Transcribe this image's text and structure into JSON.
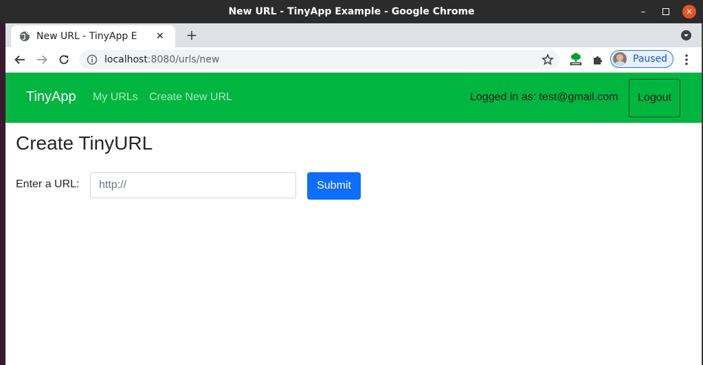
{
  "window": {
    "title": "New URL - TinyApp Example - Google Chrome",
    "minimize_glyph": "–",
    "close_glyph": "✕"
  },
  "tab": {
    "title": "New URL - TinyApp Example",
    "close_glyph": "✕",
    "new_tab_glyph": "+"
  },
  "omnibox": {
    "host": "localhost",
    "path": ":8080/urls/new"
  },
  "profile": {
    "label": "Paused",
    "accent": "#1a73e8"
  },
  "icons": {
    "tab": "globe-icon",
    "back": "arrow-left-icon",
    "forward": "arrow-right-icon",
    "reload": "reload-icon",
    "info": "info-icon",
    "bookmark": "star-icon",
    "ext_html": "html-validator-icon",
    "ext_puzzle": "puzzle-icon",
    "menu": "kebab-menu-icon"
  },
  "navbar": {
    "brand": "TinyApp",
    "links": [
      "My URLs",
      "Create New URL"
    ],
    "logged_in": "Logged in as: test@gmail.com",
    "logout": "Logout",
    "bg_color": "#00b640"
  },
  "form": {
    "heading": "Create TinyURL",
    "label": "Enter a URL:",
    "placeholder": "http://",
    "submit": "Submit",
    "submit_color": "#0d6efd"
  }
}
